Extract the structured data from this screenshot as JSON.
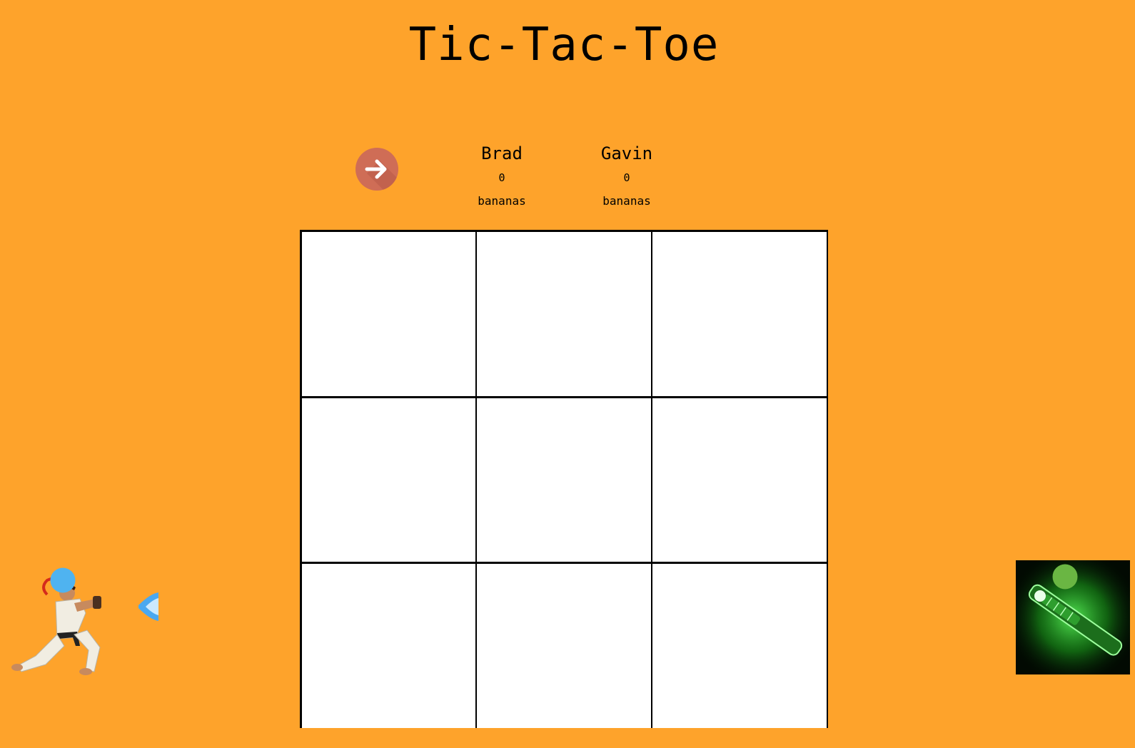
{
  "title": "Tic-Tac-Toe",
  "next_button": {
    "icon": "arrow-right-icon",
    "color": "#cf6d56"
  },
  "players": [
    {
      "name": "Brad",
      "score": "0",
      "unit": "bananas",
      "token_color": "#4fb3f0"
    },
    {
      "name": "Gavin",
      "score": "0",
      "unit": "bananas",
      "token_color": "#6ab643"
    }
  ],
  "board": {
    "cells": [
      "",
      "",
      "",
      "",
      "",
      "",
      "",
      "",
      ""
    ]
  },
  "colors": {
    "background": "#fea32b",
    "board_lines": "#000000",
    "cell": "#ffffff"
  }
}
